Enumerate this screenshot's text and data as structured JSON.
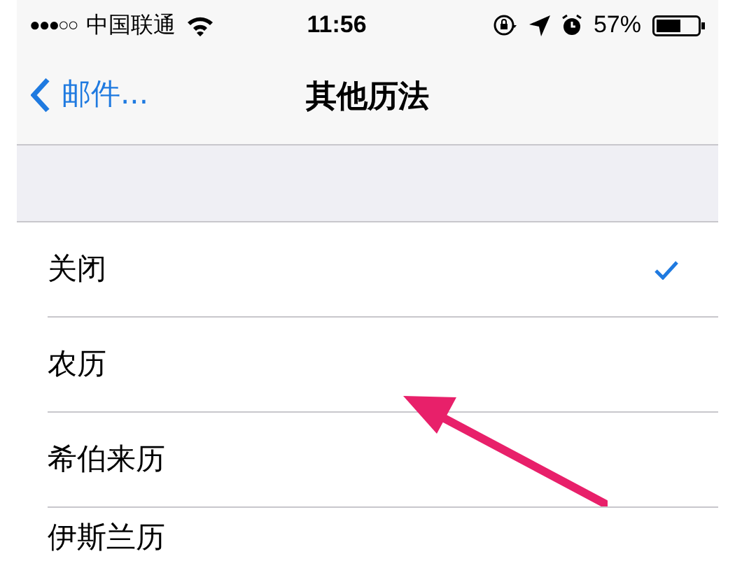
{
  "status_bar": {
    "signal": "●●●○○",
    "carrier": "中国联通",
    "time": "11:56",
    "battery": "57%"
  },
  "nav_bar": {
    "back": "邮件...",
    "title": "其他历法"
  },
  "options": [
    {
      "label": "关闭",
      "selected": true
    },
    {
      "label": "农历",
      "selected": false
    },
    {
      "label": "希伯来历",
      "selected": false
    },
    {
      "label": "伊斯兰历",
      "selected": false
    }
  ]
}
